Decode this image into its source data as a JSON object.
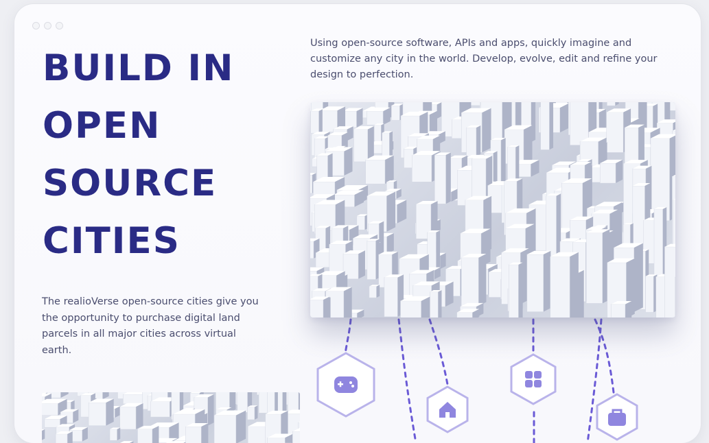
{
  "window": {
    "controls": [
      "close",
      "minimize",
      "maximize"
    ]
  },
  "hero": {
    "title_lines": [
      "BUILD IN",
      "OPEN",
      "SOURCE",
      "CITIES"
    ]
  },
  "intro_text": "Using open-source software, APIs and apps, quickly imagine and customize any city in the world. Develop, evolve, edit and refine your design to perfection.",
  "side_text": "The realioVerse open-source cities give you the opportunity to purchase digital land parcels in all major cities across virtual earth.",
  "images": {
    "main": "isometric-3d-city-render",
    "thumbnail": "isometric-3d-city-render-cropped"
  },
  "icons": [
    {
      "name": "gamepad-icon"
    },
    {
      "name": "house-icon"
    },
    {
      "name": "grid-apps-icon"
    },
    {
      "name": "briefcase-icon"
    }
  ],
  "colors": {
    "title": "#2a2b85",
    "body_text": "#4a4d6e",
    "accent_purple": "#6a5ad6",
    "icon_fill": "#8f86df",
    "hex_stroke": "#b9b3ea",
    "background": "#f8f8fc"
  }
}
